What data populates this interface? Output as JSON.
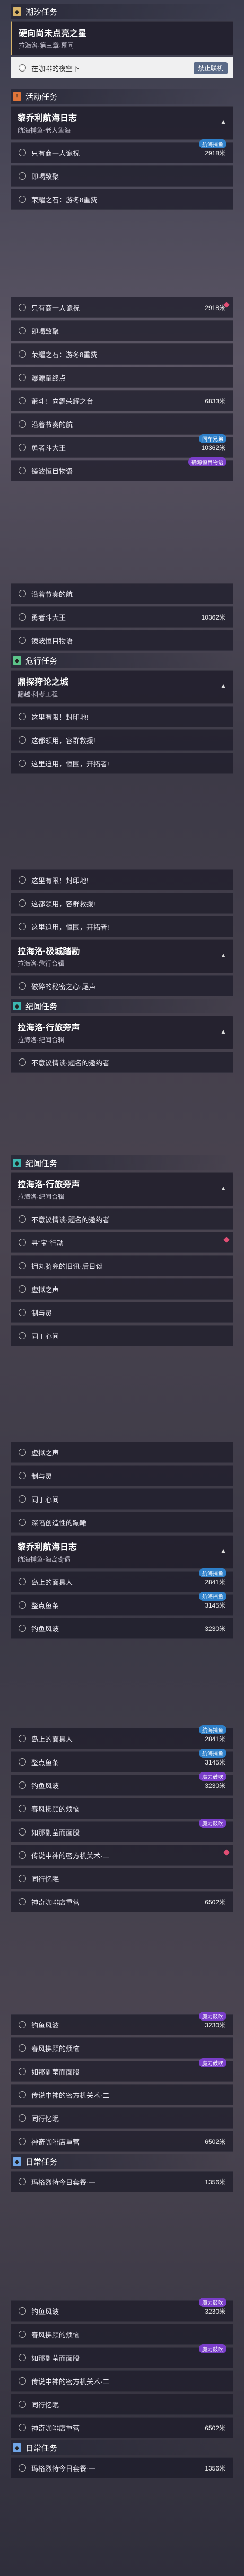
{
  "sections": {
    "tide": "潮汐任务",
    "activity": "活动任务",
    "danger": "危行任务",
    "disc": "纪闻任务",
    "disc2": "纪闻任务",
    "daily": "日常任务",
    "daily2": "日常任务"
  },
  "cards": {
    "c1": {
      "title": "硬向尚未点亮之星",
      "sub": "拉海洛·第三章·幕间"
    },
    "c2": {
      "title": "黎乔利航海日志",
      "sub": "航海捕鱼·老人鱼海"
    },
    "c3": {
      "title": "鼎探狩论之城",
      "sub": "翻越·科考工程"
    },
    "c4": {
      "title": "拉海洛·极城踏勘",
      "sub": "拉海洛·危行合辑"
    },
    "c5": {
      "title": "拉海洛·行旅旁声",
      "sub": "拉海洛·纪闻合辑"
    },
    "c6": {
      "title": "拉海洛·行旅旁声",
      "sub": "拉海洛·纪闻合辑"
    },
    "c7": {
      "title": "黎乔利航海日志",
      "sub": "航海捕鱼·海岛奇遇"
    }
  },
  "toggle": "禁止联机",
  "rows": {
    "r1": "在咖啡的夜空下",
    "r2": "只有商一人诡祝",
    "r2v": "2918米",
    "r3": "即喝致聚",
    "r4": "荣耀之石：游冬8重费",
    "r5": "只有商一人诡祝",
    "r5v": "2918米",
    "r6": "即喝致聚",
    "r7": "荣耀之石：游冬8重费",
    "r8": "瀑源至终点",
    "r9": "萧斗！向霸荣耀之台",
    "r9v": "6833米",
    "r10": "沿着节奏的航",
    "r11": "勇者斗大王",
    "r11v": "10362米",
    "r12": "镜波恒目物语",
    "r13": "沿着节奏的航",
    "r14": "勇者斗大王",
    "r14v": "10362米",
    "r15": "镜波恒目物语",
    "r16": "这里有限！封印地!",
    "r17": "这都领用，容群救援!",
    "r18": "这里迫用，恒围，开拓者!",
    "r19": "这里有限！封印地!",
    "r20": "这都领用，容群救援!",
    "r21": "这里迫用，恒围，开拓者!",
    "r22": "破碎的秘密之心·尾声",
    "r23": "不意议情谈·题名的邀约者",
    "r24": "不意议情谈·题名的邀约者",
    "r25": "寻“宝”行动",
    "r26": "拥丸骑兜的旧讯·后日谈",
    "r27": "虚拟之声",
    "r28": "制与灵",
    "r29": "同于心间",
    "r30": "虚拟之声",
    "r31": "制与灵",
    "r32": "同于心间",
    "r33": "深陷创造性的蹦瞰",
    "r34": "岛上的面具人",
    "r34v": "2841米",
    "r35": "整点鱼条",
    "r35v": "3145米",
    "r36": "钓鱼风波",
    "r36v": "3230米",
    "r37": "岛上的面具人",
    "r37v": "2841米",
    "r38": "整点鱼条",
    "r38v": "3145米",
    "r39": "钓鱼风波",
    "r39v": "3230米",
    "r40": "春风拂顾的烦恼",
    "r41": "如那副莹而面股",
    "r42": "传说中神的密方机关术·二",
    "r43": "同行忆眠",
    "r44": "神奇咖啡店重营",
    "r44v": "6502米",
    "r45": "钓鱼风波",
    "r45v": "3230米",
    "r46": "春风拂顾的烦恼",
    "r47": "如那副莹而面股",
    "r48": "传说中神的密方机关术·二",
    "r49": "同行忆眠",
    "r50": "神奇咖啡店重营",
    "r50v": "6502米",
    "r51": "玛格烈特今日套餐·一",
    "r51v": "1356米",
    "r52": "钓鱼风波",
    "r52v": "3230米",
    "r53": "春风拂顾的烦恼",
    "r54": "如那副莹而面股",
    "r55": "传说中神的密方机关术·二",
    "r56": "同行忆眠",
    "r57": "神奇咖啡店重营",
    "r57v": "6502米",
    "r58": "玛格烈特今日套餐·一",
    "r58v": "1356米"
  },
  "badges": {
    "fishing": "航海捕鱼",
    "trophy": "同车兄弟",
    "trophy2": "确源恒目物语",
    "magic": "魔力鼓吹"
  }
}
